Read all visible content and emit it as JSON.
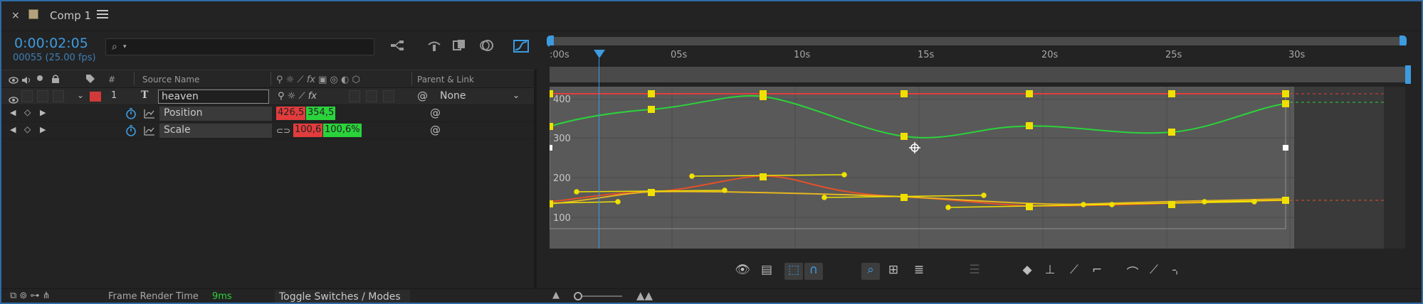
{
  "tab": {
    "close": "×",
    "title": "Comp 1",
    "brand_swatch": "#b5a27d"
  },
  "timeline": {
    "timecode": "0:00:02:05",
    "fps": "00055 (25.00 fps)",
    "search_icon": "⌕",
    "search_value": ""
  },
  "columns": {
    "num": "#",
    "source_name": "Source Name",
    "parent_link": "Parent & Link"
  },
  "layer": {
    "number": "1",
    "type_icon": "T",
    "name": "heaven",
    "label_color": "#d23a3a",
    "parent": "None"
  },
  "properties": [
    {
      "name": "Position",
      "value_x": "426,5",
      "value_y": "354,5"
    },
    {
      "name": "Scale",
      "value_x": "100,6",
      "value_y": "100,6%"
    }
  ],
  "ruler": {
    "labels": [
      ":00s",
      "05s",
      "10s",
      "15s",
      "20s",
      "25s",
      "30s"
    ]
  },
  "graph": {
    "y_labels": [
      "400",
      "300",
      "200",
      "100"
    ]
  },
  "status": {
    "frame_render_label": "Frame Render Time",
    "frame_render_value": "9ms",
    "toggle_label": "Toggle Switches / Modes"
  },
  "colors": {
    "accent": "#3d9be0",
    "red_channel": "#e23c3c",
    "green_channel": "#2bd33b",
    "keyframe": "#f0e000",
    "speed_curve": "#e6b520"
  }
}
